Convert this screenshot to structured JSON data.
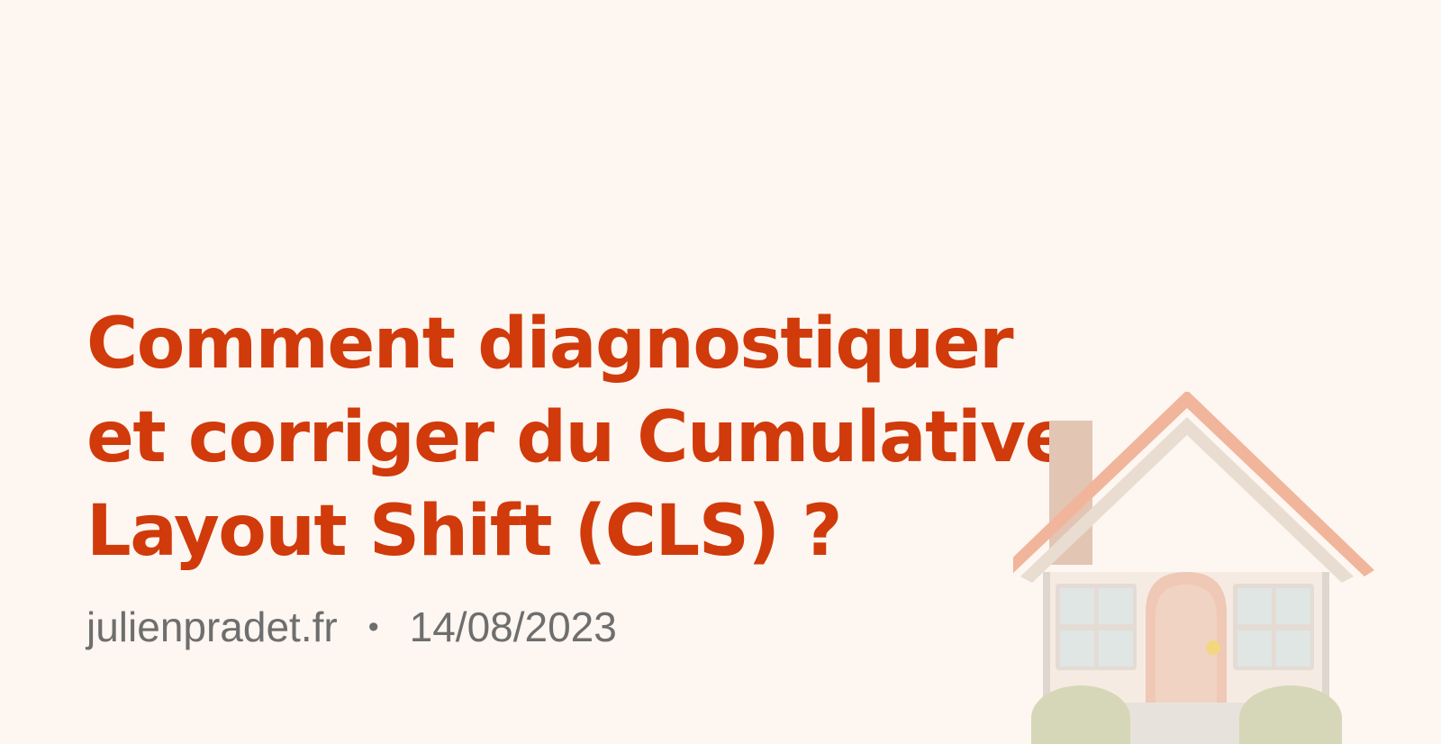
{
  "post": {
    "title_lines": [
      "Comment diagnostiquer",
      "et corriger du Cumulative",
      "Layout Shift (CLS) ?"
    ],
    "site": "julienpradet.fr",
    "separator": "•",
    "date": "14/08/2023"
  },
  "illustration": {
    "icon": "house-icon"
  },
  "colors": {
    "background": "#fdf6f1",
    "title": "#d13a0a",
    "meta": "#6e6e6e"
  }
}
